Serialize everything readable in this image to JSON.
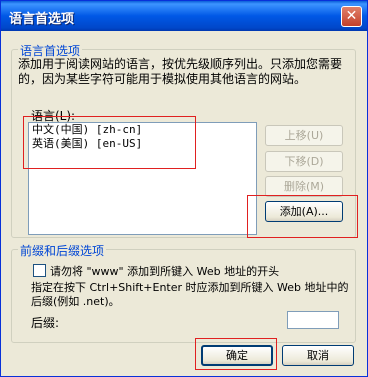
{
  "window": {
    "title": "语言首选项",
    "close_glyph": "✕"
  },
  "language_group": {
    "legend": "语言首选项",
    "description": "添加用于阅读网站的语言，按优先级顺序列出。只添加您需要的，因为某些字符可能用于模拟使用其他语言的网站。",
    "list_label": "语言(L):",
    "languages": [
      "中文(中国) [zh-cn]",
      "英语(美国) [en-US]"
    ],
    "move_up_label": "上移(U)",
    "move_down_label": "下移(D)",
    "remove_label": "删除(M)",
    "add_label": "添加(A)..."
  },
  "prefix_group": {
    "legend": "前缀和后缀选项",
    "checkbox_label": "请勿将 \"www\" 添加到所键入 Web 地址的开头",
    "checkbox_checked": false,
    "hint": "指定在按下 Ctrl+Shift+Enter 时应添加到所键入 Web 地址中的后缀(例如 .net)。",
    "suffix_label": "后缀:",
    "suffix_value": ""
  },
  "footer": {
    "ok_label": "确定",
    "cancel_label": "取消"
  },
  "colors": {
    "titlebar": "#0058e6",
    "legend_text": "#0046d5",
    "dialog_bg": "#ece9d8",
    "highlight_box": "#e02020"
  }
}
